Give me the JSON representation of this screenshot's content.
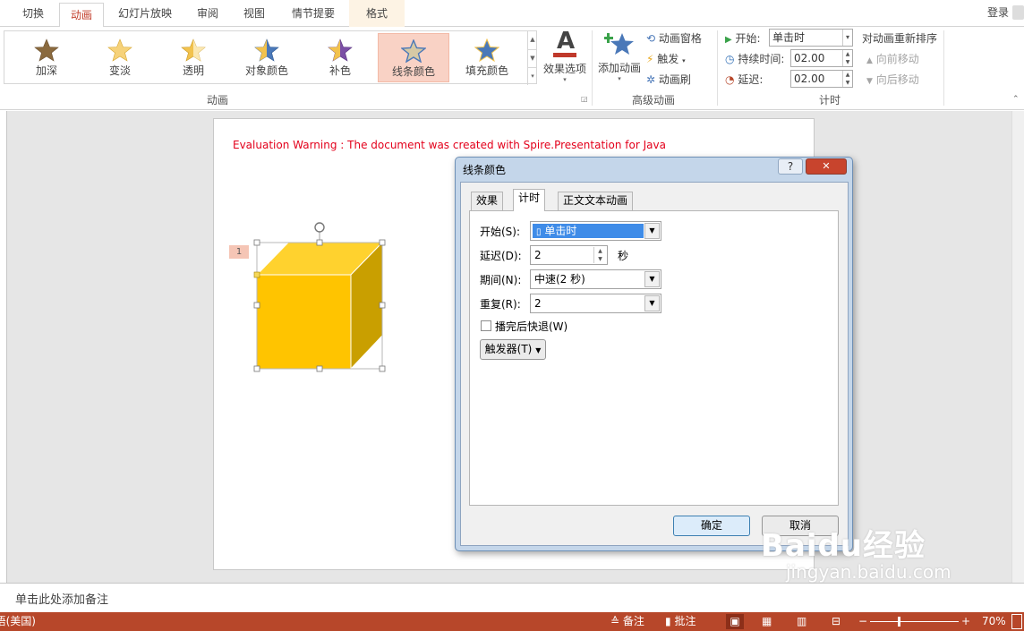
{
  "tabs": [
    "切换",
    "动画",
    "幻灯片放映",
    "审阅",
    "视图",
    "情节提要",
    "格式"
  ],
  "login": "登录",
  "gallery": {
    "items": [
      {
        "label": "加深",
        "color": "#8a6a3e"
      },
      {
        "label": "变淡",
        "color": "#f2c24d"
      },
      {
        "label": "透明",
        "color": "#f2c24d"
      },
      {
        "label": "对象颜色",
        "color": "#4a78b8"
      },
      {
        "label": "补色",
        "color": "#7b4fa6"
      },
      {
        "label": "线条颜色",
        "color": "#c9c3b3"
      },
      {
        "label": "填充颜色",
        "color": "#4a78b8"
      }
    ],
    "selected": "线条颜色"
  },
  "effect_options": {
    "label": "效果选项",
    "icon_letter": "A"
  },
  "group_labels": {
    "animation": "动画",
    "advanced": "高级动画",
    "timing": "计时"
  },
  "advanced": {
    "add_animation": "添加动画",
    "animation_pane": "动画窗格",
    "trigger": "触发",
    "painter": "动画刷"
  },
  "timing": {
    "start_label": "开始:",
    "start_value": "单击时",
    "duration_label": "持续时间:",
    "duration_value": "02.00",
    "delay_label": "延迟:",
    "delay_value": "02.00",
    "reorder_label": "对动画重新排序",
    "move_earlier": "向前移动",
    "move_later": "向后移动"
  },
  "slide": {
    "warning": "Evaluation Warning : The document was created with  Spire.Presentation for Java",
    "anim_tag": "1",
    "cube_colors": {
      "front": "#ffc400",
      "top": "#ffd22e",
      "side": "#c99f00"
    }
  },
  "dialog": {
    "title": "线条颜色",
    "help": "?",
    "close": "✕",
    "tabs": [
      "效果",
      "计时",
      "正文文本动画"
    ],
    "start_label": "开始(S):",
    "start_value": "单击时",
    "delay_label": "延迟(D):",
    "delay_value": "2",
    "delay_unit": "秒",
    "period_label": "期间(N):",
    "period_value": "中速(2 秒)",
    "repeat_label": "重复(R):",
    "repeat_value": "2",
    "rewind_label": "播完后快退(W)",
    "triggers_label": "触发器(T)",
    "ok": "确定",
    "cancel": "取消"
  },
  "notes_placeholder": "单击此处添加备注",
  "status": {
    "language": "英语(美国)",
    "notes": "备注",
    "comments": "批注",
    "zoom": "70%"
  },
  "watermark": {
    "brand": "Baidu经验",
    "url": "jingyan.baidu.com"
  }
}
